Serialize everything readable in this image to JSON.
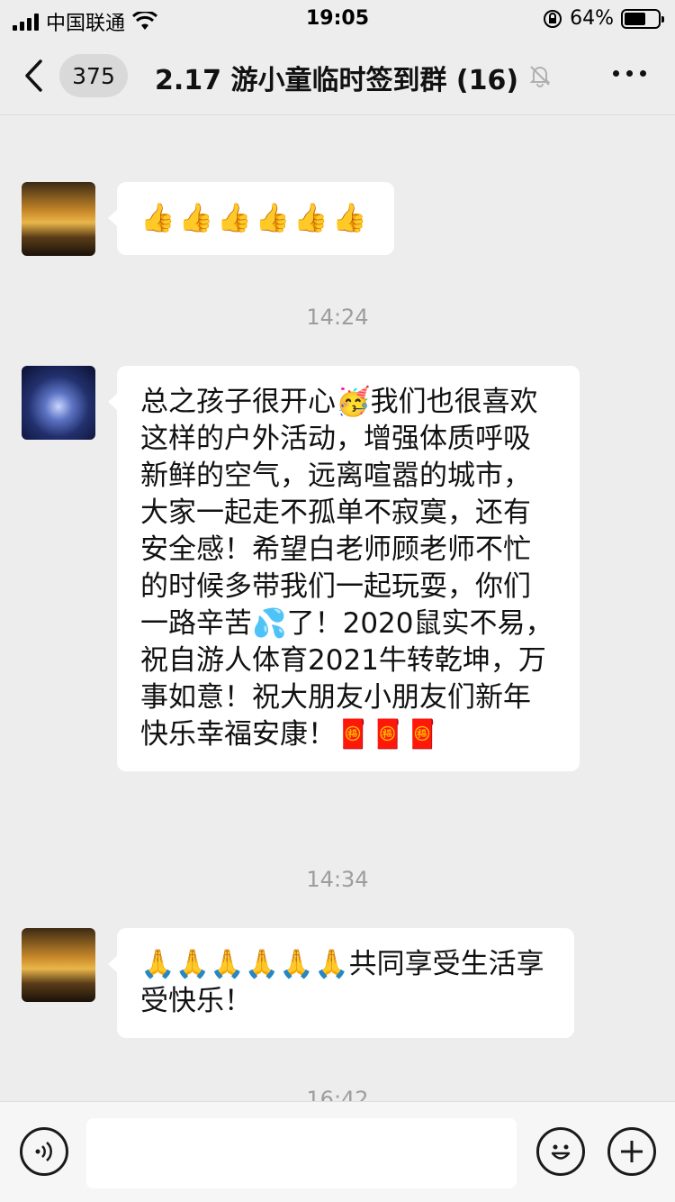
{
  "status_bar": {
    "carrier": "中国联通",
    "time": "19:05",
    "battery": "64%",
    "battery_level": 0.64
  },
  "nav": {
    "unread_count": "375",
    "title": "2.17 游小童临时签到群 (16)"
  },
  "messages": [
    {
      "type": "bubble",
      "content": "🎊"
    },
    {
      "type": "bubble",
      "content": "👍👍👍👍👍👍"
    },
    {
      "type": "time",
      "content": "14:24"
    },
    {
      "type": "bubble",
      "content": "总之孩子很开心🥳我们也很喜欢这样的户外活动，增强体质呼吸新鲜的空气，远离喧嚣的城市，大家一起走不孤单不寂寞，还有安全感！希望白老师顾老师不忙的时候多带我们一起玩耍，你们一路辛苦💦了！2020鼠实不易，祝自游人体育2021牛转乾坤，万事如意！祝大朋友小朋友们新年快乐幸福安康！🧧🧧🧧"
    },
    {
      "type": "time",
      "content": "14:34"
    },
    {
      "type": "bubble",
      "content": "🙏🙏🙏🙏🙏🙏共同享受生活享受快乐！"
    },
    {
      "type": "time",
      "content": "16:42"
    }
  ]
}
